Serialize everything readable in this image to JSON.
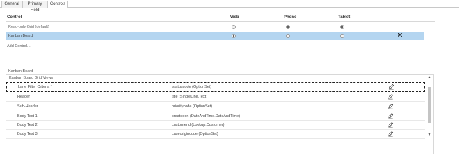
{
  "tabs": [
    {
      "label": "General",
      "active": false
    },
    {
      "label": "Primary Field",
      "active": false
    },
    {
      "label": "Controls",
      "active": true
    }
  ],
  "controls": {
    "headers": {
      "control": "Control",
      "web": "Web",
      "phone": "Phone",
      "tablet": "Tablet"
    },
    "rows": [
      {
        "name": "Read-only Grid (default)",
        "web": false,
        "phone": true,
        "tablet": true,
        "selected": false
      },
      {
        "name": "Kanban Board",
        "web": true,
        "phone": false,
        "tablet": false,
        "selected": true
      }
    ],
    "add_link": "Add Control..."
  },
  "kanban": {
    "title": "Kanban Board",
    "subtitle": "Kanban Board Grid Views",
    "rows": [
      {
        "label": "Lane Filter Criteria *",
        "value": "statuscode (OptionSet)"
      },
      {
        "label": "Header",
        "value": "title (SingleLine.Text)"
      },
      {
        "label": "Sub-Header",
        "value": "prioritycode (OptionSet)"
      },
      {
        "label": "Body Text 1",
        "value": "createdon (DateAndTime.DateAndTime)"
      },
      {
        "label": "Body Text 2",
        "value": "customerid (Lookup.Customer)"
      },
      {
        "label": "Body Text 3",
        "value": "caseorigincode (OptionSet)"
      }
    ]
  },
  "icons": {
    "remove": "close-icon",
    "edit": "pencil-icon",
    "scroll_up": "scroll-up-arrow-icon",
    "scroll_down": "scroll-down-arrow-icon"
  },
  "colors": {
    "selected_row": "#b4d5f0",
    "border": "#c8c8c8"
  }
}
